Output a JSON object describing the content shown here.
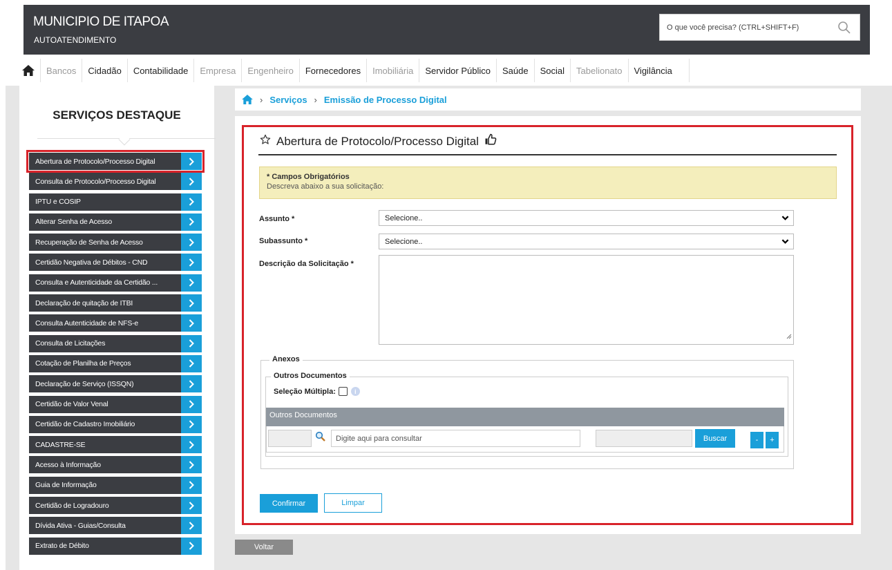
{
  "header": {
    "title": "MUNICIPIO DE ITAPOA",
    "subtitle": "AUTOATENDIMENTO",
    "search_placeholder": "O que você precisa? (CTRL+SHIFT+F)",
    "search_icon": "search-icon"
  },
  "nav": {
    "home_icon": "home-icon",
    "items": [
      {
        "label": "Bancos",
        "enabled": false
      },
      {
        "label": "Cidadão",
        "enabled": true
      },
      {
        "label": "Contabilidade",
        "enabled": true
      },
      {
        "label": "Empresa",
        "enabled": false
      },
      {
        "label": "Engenheiro",
        "enabled": false
      },
      {
        "label": "Fornecedores",
        "enabled": true
      },
      {
        "label": "Imobiliária",
        "enabled": false
      },
      {
        "label": "Servidor Público",
        "enabled": true
      },
      {
        "label": "Saúde",
        "enabled": true
      },
      {
        "label": "Social",
        "enabled": true
      },
      {
        "label": "Tabelionato",
        "enabled": false
      },
      {
        "label": "Vigilância",
        "enabled": true
      }
    ]
  },
  "sidebar": {
    "title": "SERVIÇOS DESTAQUE",
    "items": [
      {
        "label": "Abertura de Protocolo/Processo Digital"
      },
      {
        "label": "Consulta de Protocolo/Processo Digital"
      },
      {
        "label": "IPTU e COSIP"
      },
      {
        "label": "Alterar Senha de Acesso"
      },
      {
        "label": "Recuperação de Senha de Acesso"
      },
      {
        "label": "Certidão Negativa de Débitos - CND"
      },
      {
        "label": "Consulta e Autenticidade da Certidão ..."
      },
      {
        "label": "Declaração de quitação de ITBI"
      },
      {
        "label": "Consulta Autenticidade de NFS-e"
      },
      {
        "label": "Consulta de Licitações"
      },
      {
        "label": "Cotação de Planilha de Preços"
      },
      {
        "label": "Declaração de Serviço (ISSQN)"
      },
      {
        "label": "Certidão de Valor Venal"
      },
      {
        "label": "Certidão de Cadastro Imobiliário"
      },
      {
        "label": "CADASTRE-SE"
      },
      {
        "label": "Acesso à Informação"
      },
      {
        "label": "Guia de Informação"
      },
      {
        "label": "Certidão de Logradouro"
      },
      {
        "label": "Dívida Ativa - Guias/Consulta"
      },
      {
        "label": "Extrato de Débito"
      }
    ]
  },
  "breadcrumb": {
    "items": [
      "Serviços",
      "Emissão de Processo Digital"
    ]
  },
  "form": {
    "title": "Abertura de Protocolo/Processo Digital",
    "notice_title": "* Campos Obrigatórios",
    "notice_text": "Descreva abaixo a sua solicitação:",
    "assunto_label": "Assunto *",
    "assunto_value": "Selecione..",
    "subassunto_label": "Subassunto *",
    "subassunto_value": "Selecione..",
    "descricao_label": "Descrição da Solicitação *",
    "anexos_legend": "Anexos",
    "outros_legend": "Outros Documentos",
    "multi_label": "Seleção Múltipla:",
    "grid_header": "Outros Documentos",
    "consult_placeholder": "Digite aqui para consultar",
    "buscar_label": "Buscar",
    "minus_label": "-",
    "plus_label": "+",
    "confirm_label": "Confirmar",
    "clear_label": "Limpar"
  },
  "footer": {
    "back_label": "Voltar"
  },
  "colors": {
    "accent": "#1a9fd9",
    "dark": "#3b3d42",
    "highlight": "#d8232a"
  }
}
